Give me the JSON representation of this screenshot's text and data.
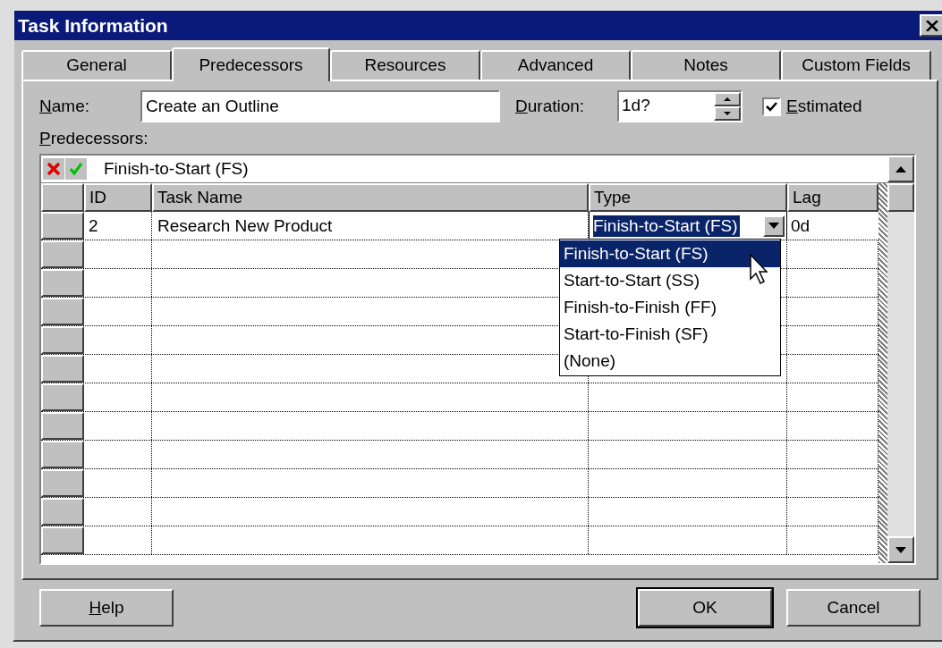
{
  "window": {
    "title": "Task Information"
  },
  "tabs": [
    {
      "label": "General",
      "selected": false
    },
    {
      "label": "Predecessors",
      "selected": true
    },
    {
      "label": "Resources",
      "selected": false
    },
    {
      "label": "Advanced",
      "selected": false
    },
    {
      "label": "Notes",
      "selected": false
    },
    {
      "label": "Custom Fields",
      "selected": false
    }
  ],
  "name_field": {
    "label": "Name:",
    "mnemonic": true,
    "value": "Create an Outline"
  },
  "duration_field": {
    "label": "Duration:",
    "mnemonic": true,
    "value": "1d?"
  },
  "estimated": {
    "label": "Estimated",
    "mnemonic": true,
    "checked": true
  },
  "predecessors": {
    "label": "Predecessors:",
    "mnemonic": true,
    "entry_value": "Finish-to-Start (FS)",
    "columns": [
      "ID",
      "Task Name",
      "Type",
      "Lag"
    ],
    "rows": [
      {
        "id": "2",
        "task_name": "Research New Product",
        "type": "Finish-to-Start (FS)",
        "lag": "0d"
      }
    ],
    "type_dropdown": [
      {
        "label": "Finish-to-Start (FS)",
        "selected": true
      },
      {
        "label": "Start-to-Start (SS)",
        "selected": false
      },
      {
        "label": "Finish-to-Finish (FF)",
        "selected": false
      },
      {
        "label": "Start-to-Finish (SF)",
        "selected": false
      },
      {
        "label": "(None)",
        "selected": false
      }
    ]
  },
  "buttons": [
    {
      "label": "Help",
      "mnemonic": true,
      "default": false
    },
    {
      "label": "OK",
      "mnemonic": false,
      "default": true
    },
    {
      "label": "Cancel",
      "mnemonic": false,
      "default": false
    }
  ]
}
